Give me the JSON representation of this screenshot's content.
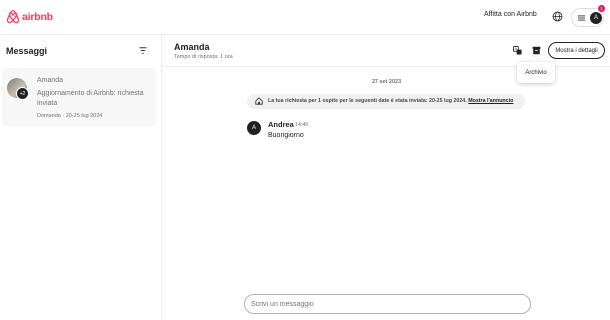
{
  "header": {
    "logo_text": "airbnb",
    "host_link": "Affitta con Airbnb",
    "globe_icon": "globe-icon",
    "menu_icon": "hamburger-icon",
    "avatar_initial": "A",
    "notification_count": "1"
  },
  "sidebar": {
    "title": "Messaggi",
    "filter_icon": "filter-icon",
    "conversations": [
      {
        "name": "Amanda",
        "badge": "+2",
        "message": "Aggiornamento di Airbnb: richiesta inviata",
        "meta": "Domanda · 20-25 lug 2024"
      }
    ]
  },
  "chat": {
    "name": "Amanda",
    "response_time": "Tempo di risposta: 1 ora",
    "translate_icon": "translate-icon",
    "archive_icon": "archive-icon",
    "details_button": "Mostra i dettagli",
    "tooltip": "Archivio",
    "date_divider": "27 set 2023",
    "notice": {
      "text": "La tua richiesta per 1 ospite per le seguenti date è stata inviata: 20-25 lug 2024.",
      "link": "Mostra l'annuncio"
    },
    "messages": [
      {
        "avatar_initial": "A",
        "sender": "Andrea",
        "time": "14:46",
        "text": "Buongiorno"
      }
    ],
    "composer_placeholder": "Scrivi un messaggio"
  },
  "colors": {
    "brand": "#ff385c",
    "notification": "#e31c5f",
    "text_primary": "#222222",
    "text_secondary": "#717171",
    "border": "#ebebeb",
    "selected_bg": "#f7f7f7"
  }
}
